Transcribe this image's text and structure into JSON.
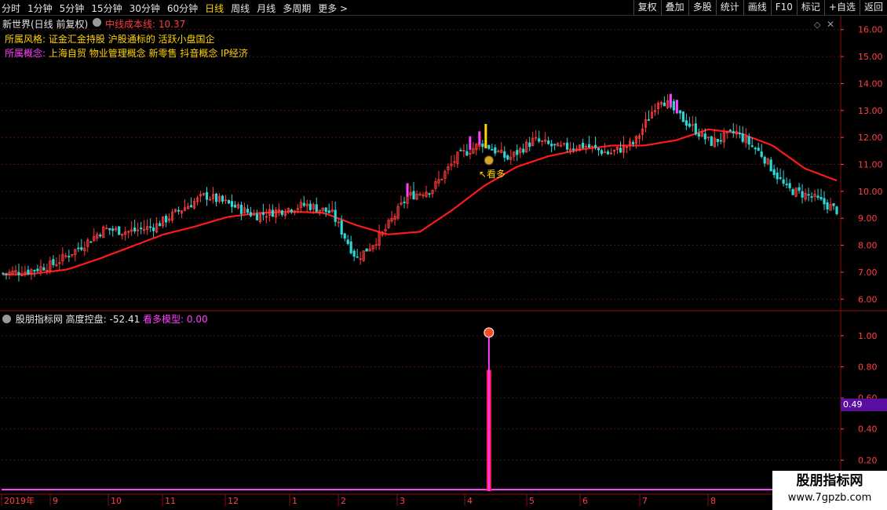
{
  "toolbar": {
    "periods": [
      "分时",
      "1分钟",
      "5分钟",
      "15分钟",
      "30分钟",
      "60分钟",
      "日线",
      "周线",
      "月线",
      "多周期",
      "更多 >"
    ],
    "active_period": "日线",
    "actions": [
      "复权",
      "叠加",
      "多股",
      "统计",
      "画线",
      "F10",
      "标记",
      "+自选",
      "返回"
    ]
  },
  "header": {
    "title": "新世界(日线 前复权)",
    "midline": "中线成本线: 10.37",
    "style_label": "所属风格:",
    "style_value": "证金汇金持股 沪股通标的 活跃小盘国企",
    "concept_label": "所属概念:",
    "concept_value": "上海自贸 物业管理概念 新零售 抖音概念 IP经济"
  },
  "indicator": {
    "name": "股朋指标网",
    "height_label": "高度控盘: -52.41",
    "model_label": "看多模型: 0.00",
    "cursor_value": "0.49"
  },
  "annotation": {
    "signal_text": "↖看多"
  },
  "watermark": {
    "title": "股朋指标网",
    "url": "www.7gpzb.com"
  },
  "colors": {
    "up": "#ff3c3c",
    "down": "#2fd6d6",
    "ma": "#ff1a1a",
    "signal": "#ff40ff",
    "axis": "#ff4040",
    "highlight": "#ffd400",
    "background": "#000000"
  },
  "icons": [
    "collapse-circle-icon",
    "diamond-icon",
    "close-icon",
    "money-bag-icon",
    "signal-badge-icon"
  ],
  "chart_data": [
    {
      "type": "candlestick",
      "title": "新世界(日线 前复权)",
      "ylim": [
        5.6,
        16.4
      ],
      "yticks": [
        6.0,
        7.0,
        8.0,
        9.0,
        10.0,
        11.0,
        12.0,
        13.0,
        14.0,
        15.0,
        16.0
      ],
      "date_labels": [
        "2019年",
        "9",
        "10",
        "11",
        "12",
        "1",
        "2",
        "3",
        "4",
        "5",
        "6",
        "7",
        "8"
      ],
      "close_anchors": [
        6.95,
        7.05,
        7.3,
        7.9,
        8.6,
        8.5,
        8.7,
        9.3,
        9.85,
        9.5,
        9.1,
        9.3,
        9.5,
        9.2,
        7.5,
        8.4,
        9.8,
        10.1,
        11.3,
        11.8,
        11.2,
        11.9,
        11.6,
        11.7,
        11.4,
        11.8,
        13.5,
        12.6,
        11.8,
        12.2,
        11.4,
        10.1,
        9.8,
        9.3
      ],
      "ma_anchors": [
        6.9,
        6.95,
        7.1,
        7.5,
        7.95,
        8.4,
        8.7,
        9.05,
        9.2,
        9.25,
        9.2,
        8.75,
        8.4,
        8.5,
        9.3,
        10.2,
        10.9,
        11.3,
        11.55,
        11.7,
        11.7,
        11.9,
        12.3,
        12.15,
        11.7,
        10.85,
        10.4
      ],
      "signals": {
        "magenta_bar_days": [
          129,
          149,
          152,
          213,
          215
        ],
        "yellow_bar_day": 154,
        "money_bag_day": 155
      }
    },
    {
      "type": "line",
      "series": [
        {
          "name": "看多模型",
          "values": "spike to 1.00 at day 155, else 0"
        }
      ],
      "ylim": [
        0,
        1.08
      ],
      "yticks": [
        0.2,
        0.4,
        0.6,
        0.8,
        1.0
      ]
    }
  ]
}
